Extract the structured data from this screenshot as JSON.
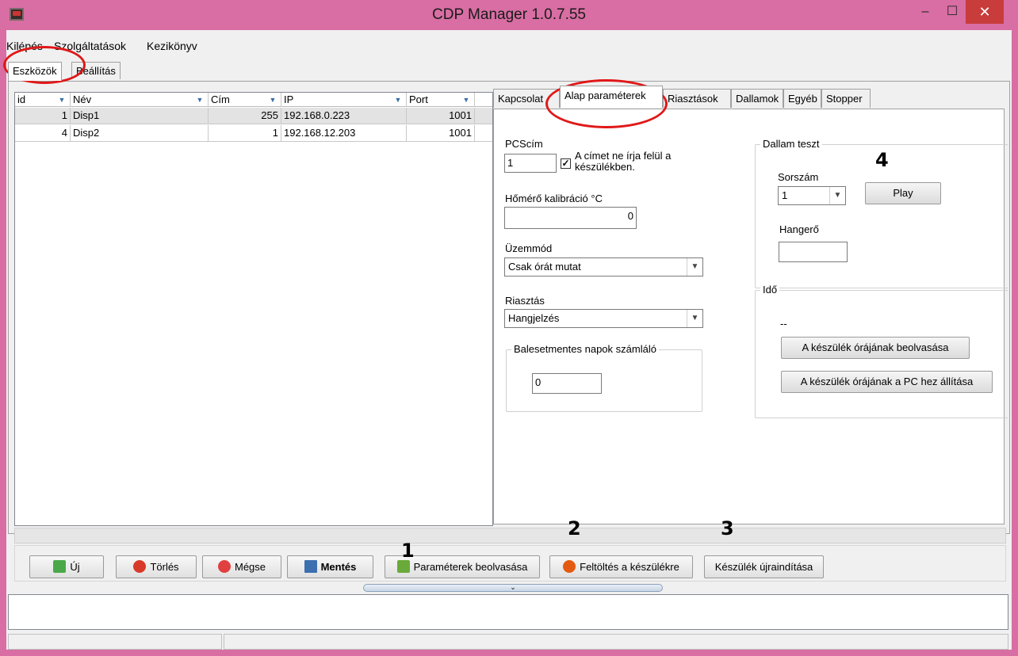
{
  "window": {
    "title": "CDP Manager 1.0.7.55"
  },
  "menu": {
    "items": [
      "Kilépés",
      "Szolgáltatások",
      "Kezikönyv"
    ]
  },
  "main_tabs": [
    "Eszközök",
    "Beállítás"
  ],
  "grid": {
    "columns": [
      "id",
      "Név",
      "Cím",
      "IP",
      "Port"
    ],
    "rows": [
      {
        "id": "1",
        "nev": "Disp1",
        "cim": "255",
        "ip": "192.168.0.223",
        "port": "1001"
      },
      {
        "id": "4",
        "nev": "Disp2",
        "cim": "1",
        "ip": "192.168.12.203",
        "port": "1001"
      }
    ]
  },
  "right_tabs": [
    "Kapcsolat",
    "Alap paraméterek",
    "Riasztások",
    "Dallamok",
    "Egyéb",
    "Stopper"
  ],
  "form": {
    "pcscim_label": "PCScím",
    "pcscim_value": "1",
    "overwrite_label_1": "A címet ne írja felül a",
    "overwrite_label_2": "készülékben.",
    "overwrite_checked": true,
    "thermo_label": "Hőmérő kalibráció °C",
    "thermo_value": "0",
    "mode_label": "Üzemmód",
    "mode_value": "Csak órát mutat",
    "alarm_label": "Riasztás",
    "alarm_value": "Hangjelzés",
    "accident_group": "Balesetmentes napok számláló",
    "accident_value": "0"
  },
  "melody": {
    "group": "Dallam teszt",
    "index_label": "Sorszám",
    "index_value": "1",
    "play_label": "Play",
    "volume_label": "Hangerő",
    "volume_value": ""
  },
  "time": {
    "group": "Idő",
    "value": "--",
    "read_button": "A készülék órájának beolvasása",
    "set_button": "A készülék órájának a PC hez állítása"
  },
  "bottom_buttons": {
    "new": "Új",
    "delete": "Törlés",
    "cancel": "Mégse",
    "save": "Mentés",
    "read_params": "Paraméterek beolvasása",
    "upload": "Feltöltés a készülékre",
    "restart": "Készülék újraindítása"
  },
  "annotations": [
    "1",
    "2",
    "3",
    "4"
  ],
  "colors": {
    "titlebar": "#d86ea3",
    "close": "#c83c3c",
    "annotation": "#e01818"
  }
}
